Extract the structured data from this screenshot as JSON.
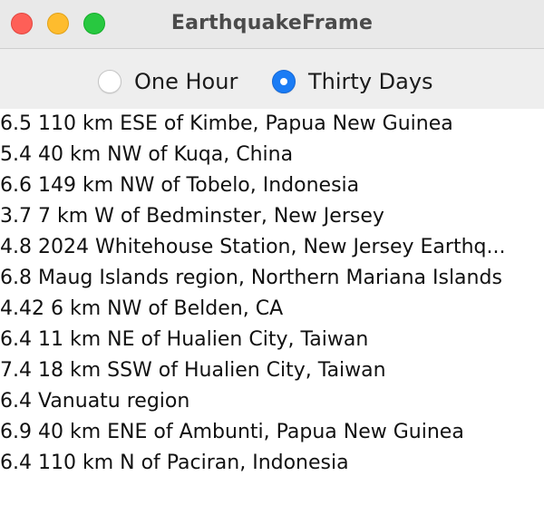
{
  "window": {
    "title": "EarthquakeFrame"
  },
  "radio": {
    "one_hour_label": "One Hour",
    "thirty_days_label": "Thirty Days",
    "selected": "thirty_days"
  },
  "earthquakes": [
    "6.5 110 km ESE of Kimbe, Papua New Guinea",
    "5.4 40 km NW of Kuqa, China",
    "6.6 149 km NW of Tobelo, Indonesia",
    "3.7 7 km W of Bedminster, New Jersey",
    "4.8 2024 Whitehouse Station, New Jersey Earthq...",
    "6.8 Maug Islands region, Northern Mariana Islands",
    "4.42 6 km NW of Belden, CA",
    "6.4 11 km NE of Hualien City, Taiwan",
    "7.4 18 km SSW of Hualien City, Taiwan",
    "6.4 Vanuatu region",
    "6.9 40 km ENE of Ambunti, Papua New Guinea",
    "6.4 110 km N of Paciran, Indonesia"
  ],
  "colors": {
    "close": "#fe5f57",
    "minimize": "#febc2e",
    "maximize": "#28c840",
    "radio_selected": "#1a7cf5"
  }
}
